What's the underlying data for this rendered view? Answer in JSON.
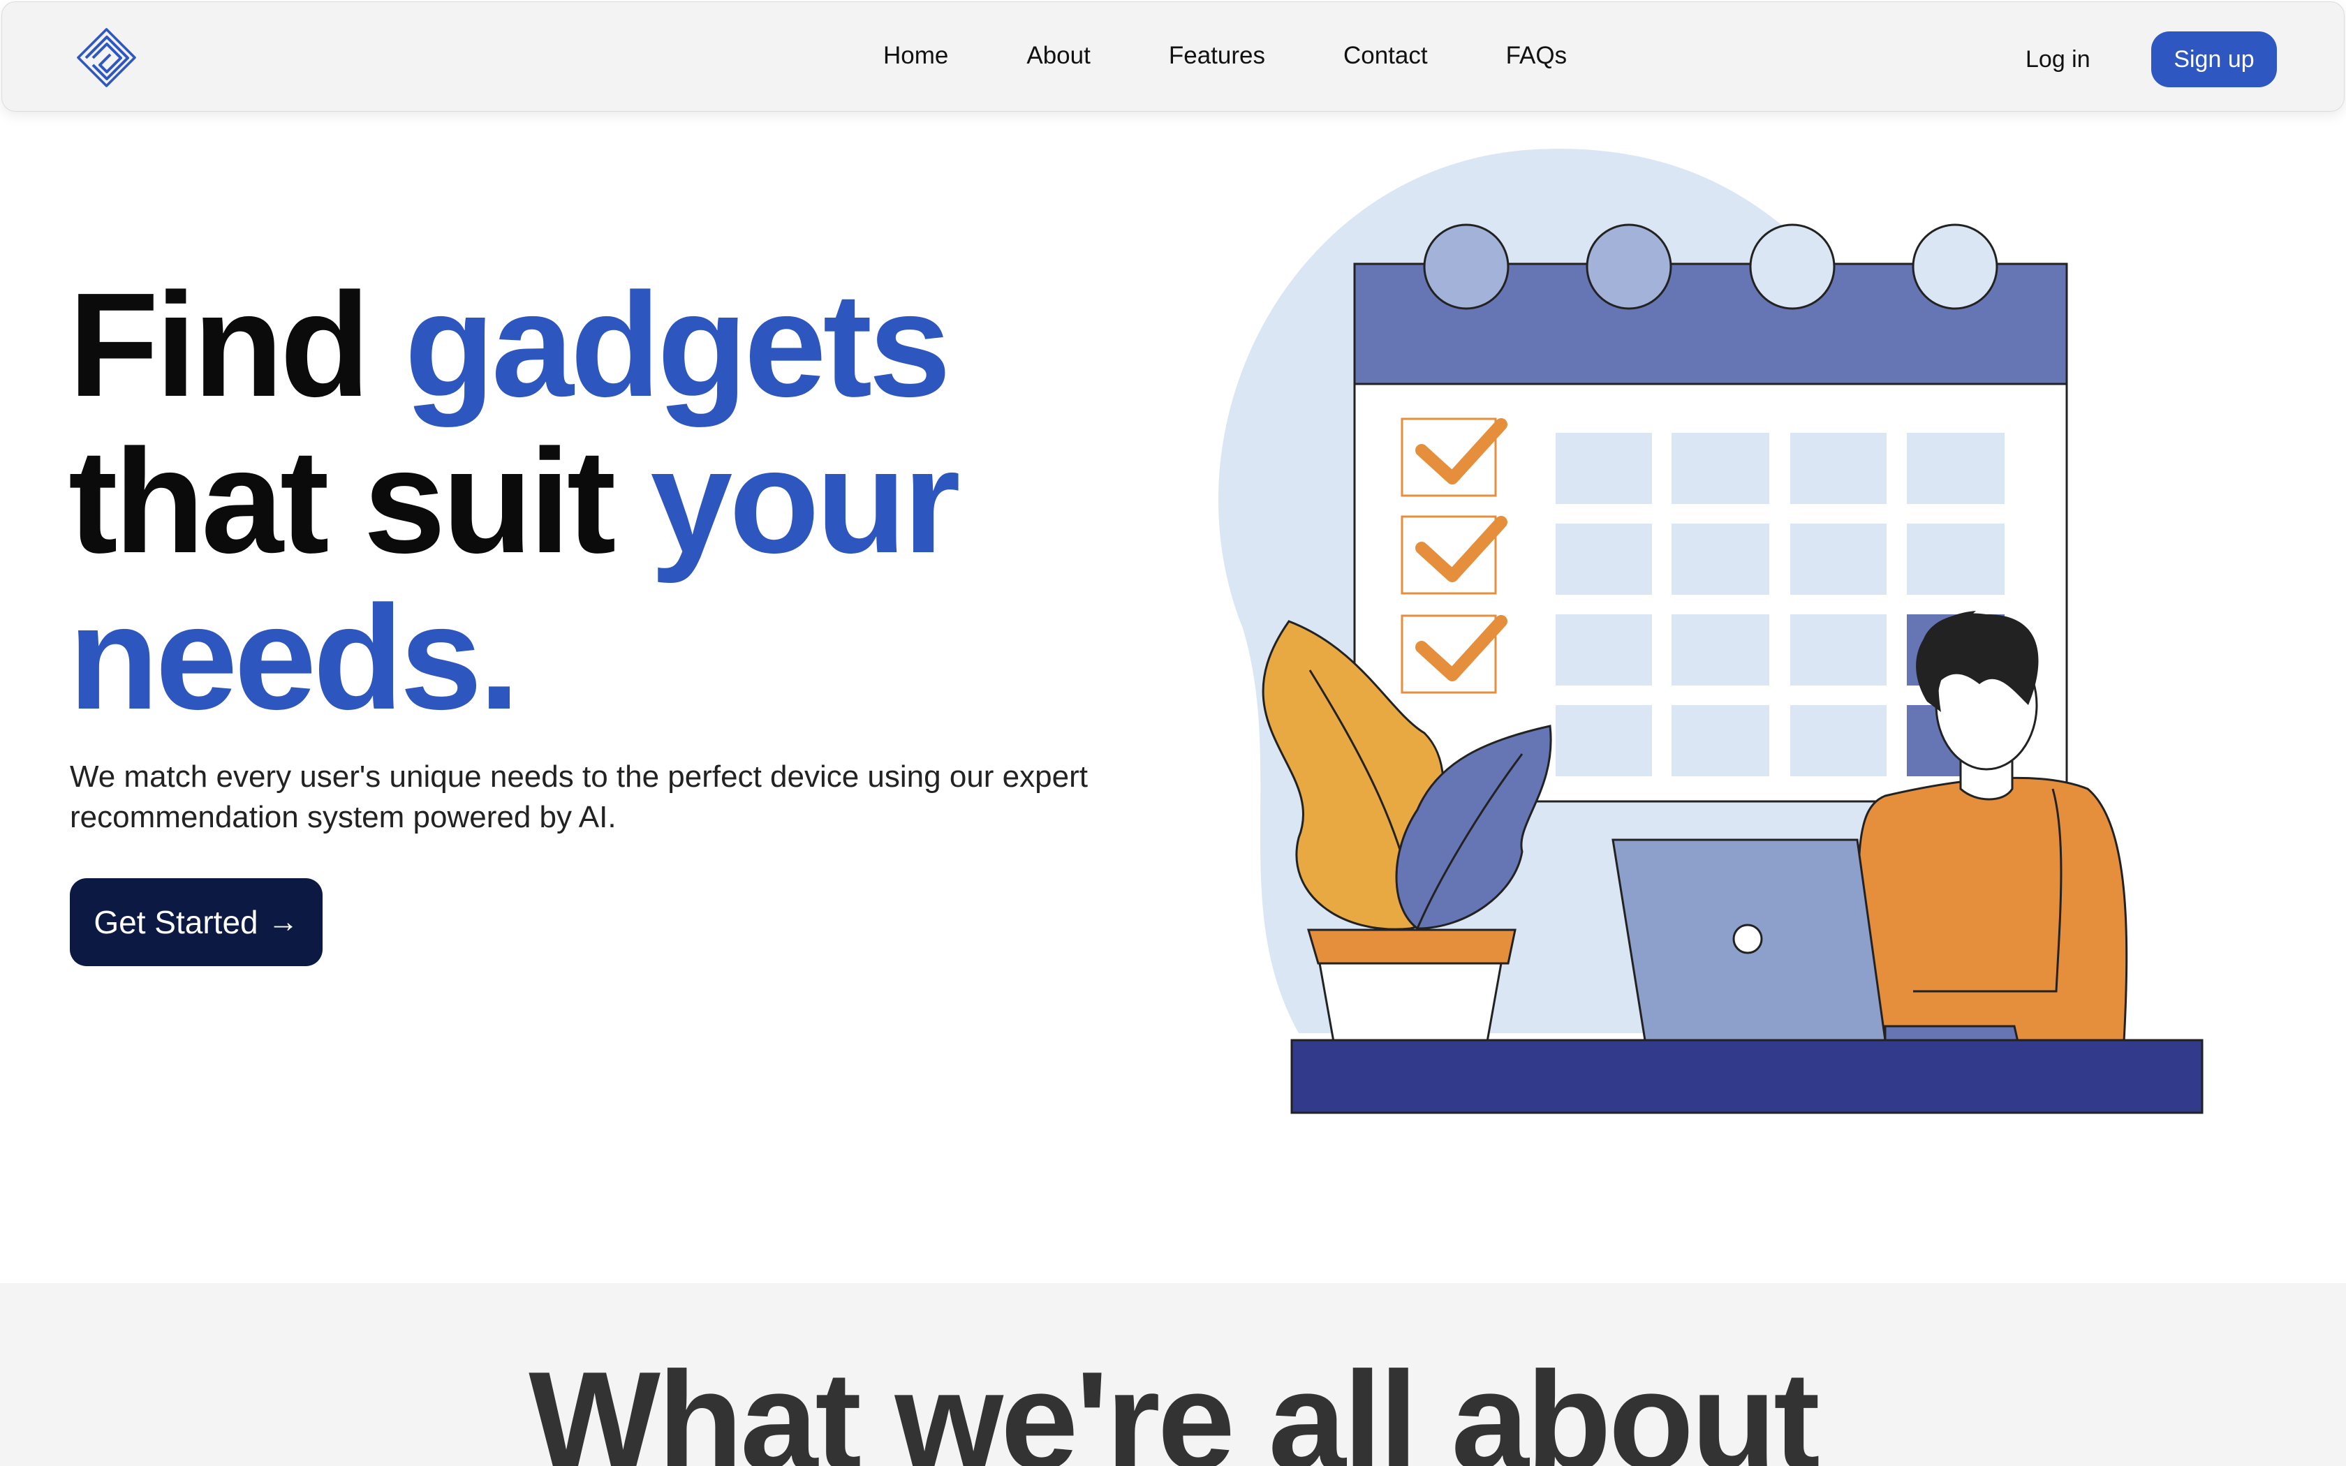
{
  "nav": {
    "links": [
      "Home",
      "About",
      "Features",
      "Contact",
      "FAQs"
    ],
    "login_label": "Log in",
    "signup_label": "Sign up"
  },
  "hero": {
    "title": {
      "w1": "Find",
      "w2": "gadgets",
      "w3": "that suit",
      "w4": "your",
      "w5": "needs."
    },
    "subtitle": "We match every user's unique needs to the perfect device using our expert recommendation system powered by AI.",
    "cta_label": "Get Started",
    "cta_arrow": "→"
  },
  "about": {
    "heading": "What we're all about"
  },
  "colors": {
    "accent": "#2e56bf",
    "signup_bg": "#2f57c2",
    "cta_bg": "#0c1a43",
    "calendar_header": "#6676b4",
    "orange": "#e58f3c",
    "desk": "#323a8c"
  },
  "icons": {
    "logo": "logo-icon",
    "cta": "arrow-right-icon"
  }
}
